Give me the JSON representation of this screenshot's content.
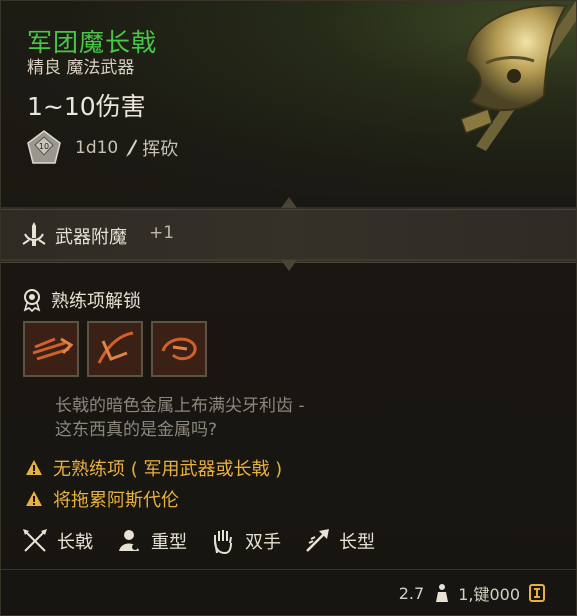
{
  "item": {
    "name": "军团魔长戟",
    "subtitle": "精良 魔法武器",
    "damage_range": "1~10伤害",
    "dice": "1d10",
    "damage_type": "挥砍",
    "die_face": "10"
  },
  "enchant": {
    "label": "武器附魔",
    "value": "+1"
  },
  "proficiency": {
    "title": "熟练项解锁",
    "skills": [
      {
        "icon": "lunge-skill-icon"
      },
      {
        "icon": "cleave-skill-icon"
      },
      {
        "icon": "sweep-skill-icon"
      }
    ]
  },
  "flavor": {
    "line1": "长戟的暗色金属上布满尖牙利齿 -",
    "line2": "这东西真的是金属吗?"
  },
  "warnings": [
    {
      "text": "无熟练项 ( 军用武器或长戟 )"
    },
    {
      "text": "将拖累阿斯代伦"
    }
  ],
  "tags": [
    {
      "label": "长戟",
      "icon": "crossed-polearm-icon"
    },
    {
      "label": "重型",
      "icon": "heavy-icon"
    },
    {
      "label": "双手",
      "icon": "hand-icon"
    },
    {
      "label": "长型",
      "icon": "reach-icon"
    }
  ],
  "footer": {
    "weight": "2.7",
    "price": "1,键000"
  },
  "colors": {
    "name_green": "#48c646",
    "warning_orange": "#e7b040",
    "text_light": "#e6e0d2",
    "text_muted": "#8c877c"
  }
}
